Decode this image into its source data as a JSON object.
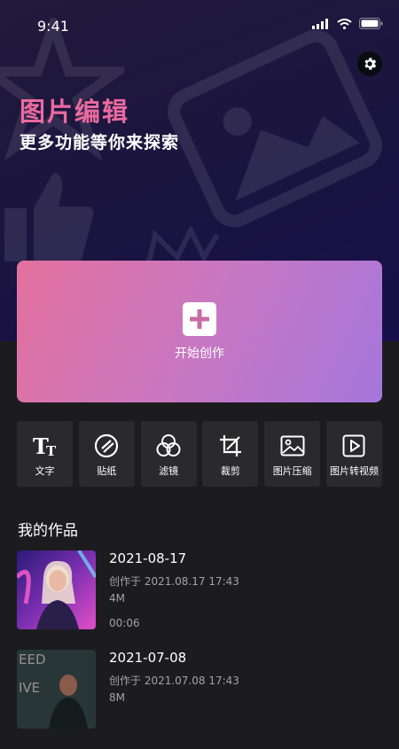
{
  "status": {
    "time": "9:41"
  },
  "header": {
    "title": "图片编辑",
    "subtitle": "更多功能等你来探索"
  },
  "create": {
    "label": "开始创作"
  },
  "tools": [
    {
      "label": "文字",
      "icon": "text-tt-icon"
    },
    {
      "label": "贴纸",
      "icon": "sticker-icon"
    },
    {
      "label": "滤镜",
      "icon": "filter-circles-icon"
    },
    {
      "label": "裁剪",
      "icon": "crop-icon"
    },
    {
      "label": "图片压缩",
      "icon": "image-icon"
    },
    {
      "label": "图片转视频",
      "icon": "play-video-icon"
    }
  ],
  "works": {
    "title": "我的作品",
    "items": [
      {
        "date": "2021-08-17",
        "created": "创作于  2021.08.17 17:43",
        "size": "4M",
        "duration": "00:06"
      },
      {
        "date": "2021-07-08",
        "created": "创作于  2021.07.08 17:43",
        "size": "8M"
      }
    ]
  },
  "colors": {
    "title_pink": "#ea6a9f",
    "gradient_start": "#e3719e",
    "gradient_end": "#a577dc",
    "background": "#1c1c1e",
    "tile": "#2a2a2d"
  }
}
